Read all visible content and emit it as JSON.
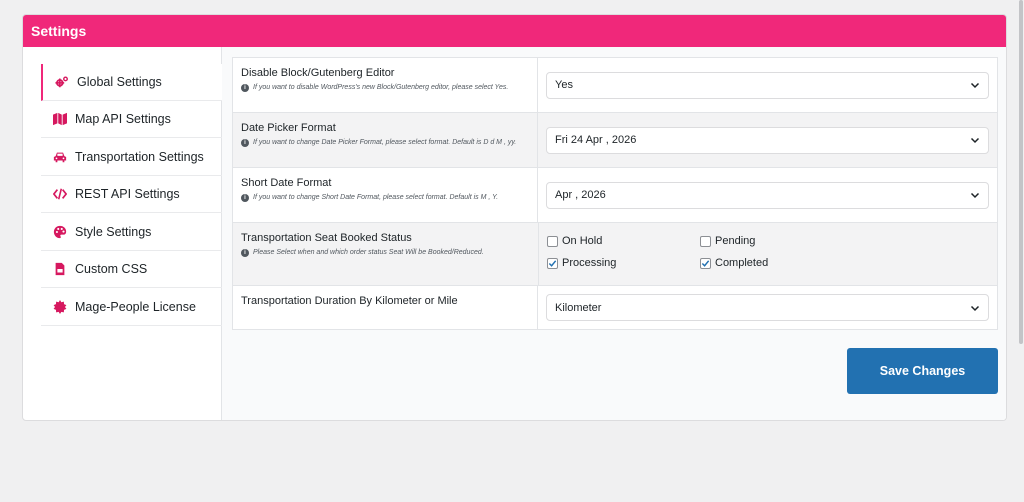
{
  "panel": {
    "title": "Settings"
  },
  "sidebar": {
    "items": [
      {
        "label": "Global Settings",
        "icon": "cogs-icon",
        "active": true
      },
      {
        "label": "Map API Settings",
        "icon": "map-icon"
      },
      {
        "label": "Transportation Settings",
        "icon": "car-icon"
      },
      {
        "label": "REST API Settings",
        "icon": "code-icon"
      },
      {
        "label": "Style Settings",
        "icon": "palette-icon"
      },
      {
        "label": "Custom CSS",
        "icon": "css-file-icon"
      },
      {
        "label": "Mage-People License",
        "icon": "certificate-icon"
      }
    ]
  },
  "settings": {
    "gutenberg": {
      "title": "Disable Block/Gutenberg Editor",
      "hint": "If you want to disable WordPress's new Block/Gutenberg editor, please select Yes.",
      "value": "Yes"
    },
    "date_picker": {
      "title": "Date Picker Format",
      "hint": "If you want to change Date Picker Format, please select format. Default is D d M , yy.",
      "value": "Fri 24 Apr , 2026"
    },
    "short_date": {
      "title": "Short Date Format",
      "hint": "If you want to change Short Date Format, please select format. Default is M , Y.",
      "value": "Apr , 2026"
    },
    "seat_status": {
      "title": "Transportation Seat Booked Status",
      "hint": "Please Select when and which order status Seat Will be Booked/Reduced.",
      "options": [
        {
          "label": "On Hold",
          "checked": false
        },
        {
          "label": "Pending",
          "checked": false
        },
        {
          "label": "Processing",
          "checked": true
        },
        {
          "label": "Completed",
          "checked": true
        }
      ]
    },
    "duration": {
      "title": "Transportation Duration By Kilometer or Mile",
      "value": "Kilometer"
    }
  },
  "actions": {
    "save_label": "Save Changes"
  },
  "colors": {
    "header": "#f0287a",
    "accent_icon": "#d6185f",
    "button": "#2271b1",
    "check": "#2271b1"
  }
}
